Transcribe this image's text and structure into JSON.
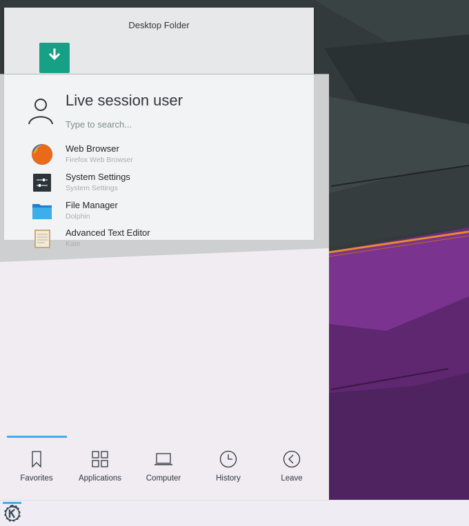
{
  "desktop_folder": {
    "title": "Desktop Folder",
    "item_icon": "download-folder-icon"
  },
  "kickoff": {
    "user_name": "Live session user",
    "search_placeholder": "Type to search...",
    "favorites": [
      {
        "name": "Web Browser",
        "description": "Firefox Web Browser",
        "icon": "firefox-icon"
      },
      {
        "name": "System Settings",
        "description": "System Settings",
        "icon": "system-settings-icon"
      },
      {
        "name": "File Manager",
        "description": "Dolphin",
        "icon": "folder-icon"
      },
      {
        "name": "Advanced Text Editor",
        "description": "Kate",
        "icon": "text-editor-icon"
      }
    ],
    "tabs": [
      {
        "label": "Favorites",
        "icon": "bookmark-icon",
        "active": true
      },
      {
        "label": "Applications",
        "icon": "grid-icon",
        "active": false
      },
      {
        "label": "Computer",
        "icon": "laptop-icon",
        "active": false
      },
      {
        "label": "History",
        "icon": "clock-icon",
        "active": false
      },
      {
        "label": "Leave",
        "icon": "back-arrow-circle-icon",
        "active": false
      }
    ]
  },
  "panel": {
    "launcher_icon": "kde-logo-icon"
  },
  "colors": {
    "accent": "#3daee9",
    "text": "#31363b",
    "subtext": "#a9adb0",
    "wallpaper_purple": "#6a2d7e",
    "wallpaper_dark": "#2b3233"
  }
}
